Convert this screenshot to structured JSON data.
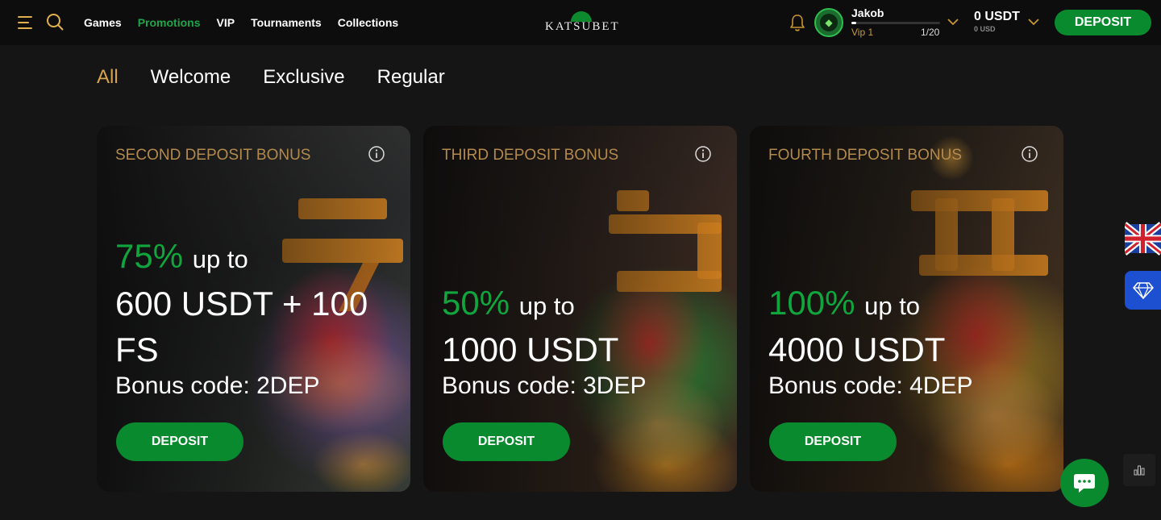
{
  "header": {
    "nav": [
      "Games",
      "Promotions",
      "VIP",
      "Tournaments",
      "Collections"
    ],
    "logo_text": "KATSUBET",
    "user": {
      "name": "Jakob",
      "vip_level": "Vip 1",
      "vip_progress": "1/20",
      "vip_fraction": 0.05
    },
    "balance": "0 USDT",
    "balance_sub": "0 USD",
    "deposit_label": "DEPOSIT"
  },
  "tabs": [
    "All",
    "Welcome",
    "Exclusive",
    "Regular"
  ],
  "cards": [
    {
      "title": "SECOND DEPOSIT BONUS",
      "percent": "75%",
      "upto": "up to",
      "amount": "600 USDT + 100 FS",
      "code": "Bonus code: 2DEP",
      "button": "DEPOSIT",
      "theme_color": "#7a4fc2"
    },
    {
      "title": "THIRD DEPOSIT BONUS",
      "percent": "50%",
      "upto": "up to",
      "amount": "1000 USDT",
      "code": "Bonus code: 3DEP",
      "button": "DEPOSIT",
      "theme_color": "#2fae3c"
    },
    {
      "title": "FOURTH DEPOSIT BONUS",
      "percent": "100%",
      "upto": "up to",
      "amount": "4000 USDT",
      "code": "Bonus code: 4DEP",
      "button": "DEPOSIT",
      "theme_color": "#c79a1e"
    }
  ],
  "colors": {
    "accent_green": "#0a8a2e",
    "percent_green": "#11a53e",
    "gold": "#d6a24a",
    "card_title": "#b48a4c"
  },
  "icons": [
    "menu-icon",
    "search-icon",
    "bell-icon",
    "chevron-down-icon",
    "info-icon",
    "uk-flag-icon",
    "diamond-icon",
    "bar-chart-icon",
    "chat-icon"
  ]
}
